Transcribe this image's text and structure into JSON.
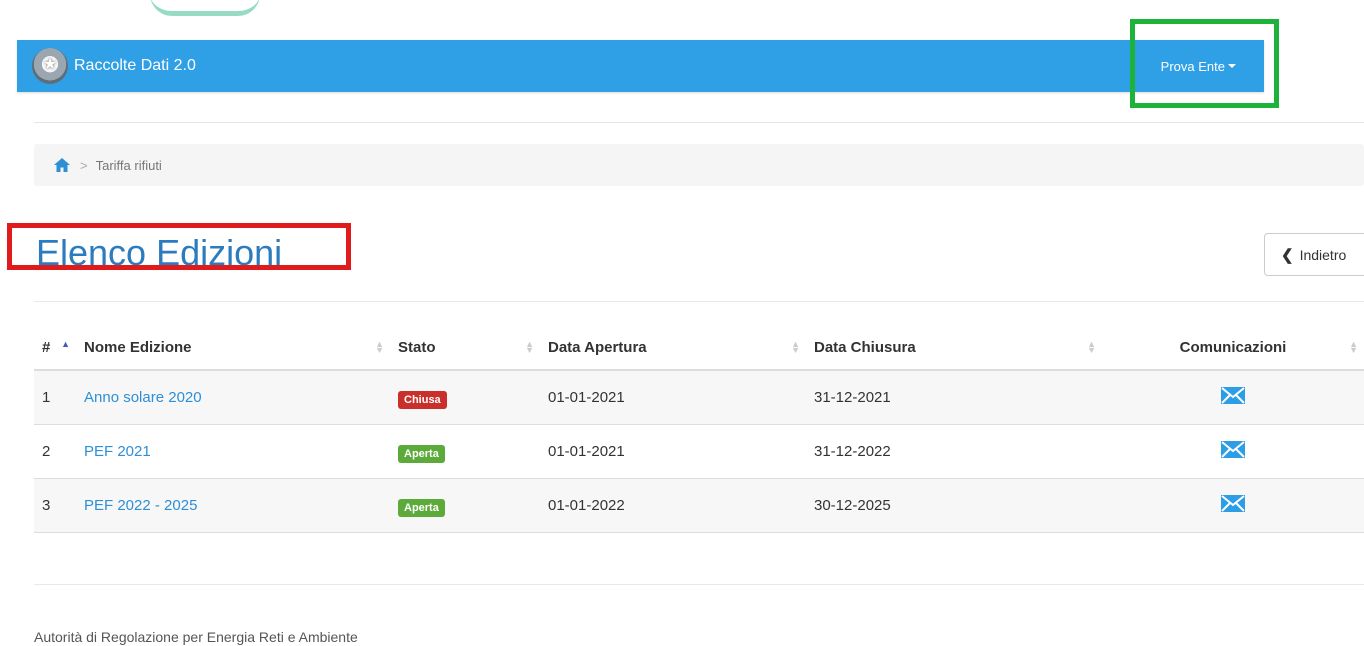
{
  "navbar": {
    "app_title": "Raccolte Dati 2.0",
    "user_menu": "Prova Ente"
  },
  "breadcrumb": {
    "current": "Tariffa rifiuti",
    "separator": ">"
  },
  "page": {
    "title": "Elenco Edizioni",
    "back_label": "Indietro"
  },
  "table": {
    "columns": [
      "#",
      "Nome Edizione",
      "Stato",
      "Data Apertura",
      "Data Chiusura",
      "Comunicazioni"
    ],
    "rows": [
      {
        "num": "1",
        "name": "Anno solare 2020",
        "status": "Chiusa",
        "status_color": "#c9302c",
        "open": "01-01-2021",
        "close": "31-12-2021"
      },
      {
        "num": "2",
        "name": "PEF 2021",
        "status": "Aperta",
        "status_color": "#5cab3a",
        "open": "01-01-2021",
        "close": "31-12-2022"
      },
      {
        "num": "3",
        "name": "PEF 2022 - 2025",
        "status": "Aperta",
        "status_color": "#5cab3a",
        "open": "01-01-2022",
        "close": "30-12-2025"
      }
    ]
  },
  "footer": {
    "text": "Autorità di Regolazione per Energia Reti e Ambiente"
  },
  "colors": {
    "navbar": "#2f9fe6",
    "title": "#2b7bbf",
    "link": "#2d8fd6"
  }
}
